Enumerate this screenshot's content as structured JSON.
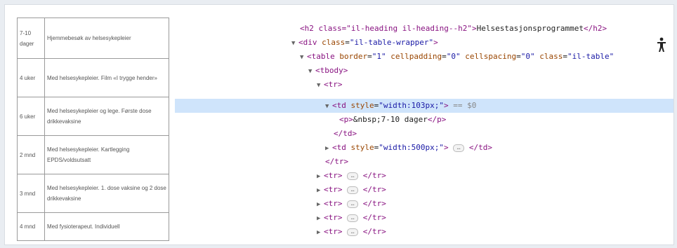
{
  "page_table": {
    "rows": [
      {
        "time": "7-10 dager",
        "desc": "Hjemmebesøk av helsesykepleier"
      },
      {
        "time": "4 uker",
        "desc": "Med helsesykepleier. Film «I trygge hender»"
      },
      {
        "time": "6 uker",
        "desc": "Med helsesykepleier og lege. Første dose drikkevaksine"
      },
      {
        "time": "2 mnd",
        "desc": "Med helsesykepleier. Kartlegging EPDS/voldsutsatt"
      },
      {
        "time": "3 mnd",
        "desc": "Med helsesykepleier. 1. dose vaksine og 2 dose drikkevaksine"
      },
      {
        "time": "4 mnd",
        "desc": "Med fysioterapeut. Individuell"
      }
    ]
  },
  "devtools": {
    "gutter_mark": "⋯",
    "lines": {
      "h2_open": "<h2 class=\"il-heading il-heading--h2\">",
      "h2_text": "Helsestasjonsprogrammet",
      "h2_close": "</h2>",
      "div_tag": "div",
      "div_attr": "class",
      "div_val": "\"il-table-wrapper\"",
      "table_tag": "table",
      "table_border_attr": "border",
      "table_border_val": "\"1\"",
      "table_cp_attr": "cellpadding",
      "table_cp_val": "\"0\"",
      "table_cs_attr": "cellspacing",
      "table_cs_val": "\"0\"",
      "table_class_attr": "class",
      "table_class_val": "\"il-table\"",
      "tbody": "tbody",
      "tr": "tr",
      "td_tag": "td",
      "td_style_attr": "style",
      "td1_style_val": "\"width:103px;\"",
      "selected_suffix": "== $0",
      "p_text": "&nbsp;7-10 dager",
      "td2_style_val": "\"width:500px;\""
    }
  }
}
